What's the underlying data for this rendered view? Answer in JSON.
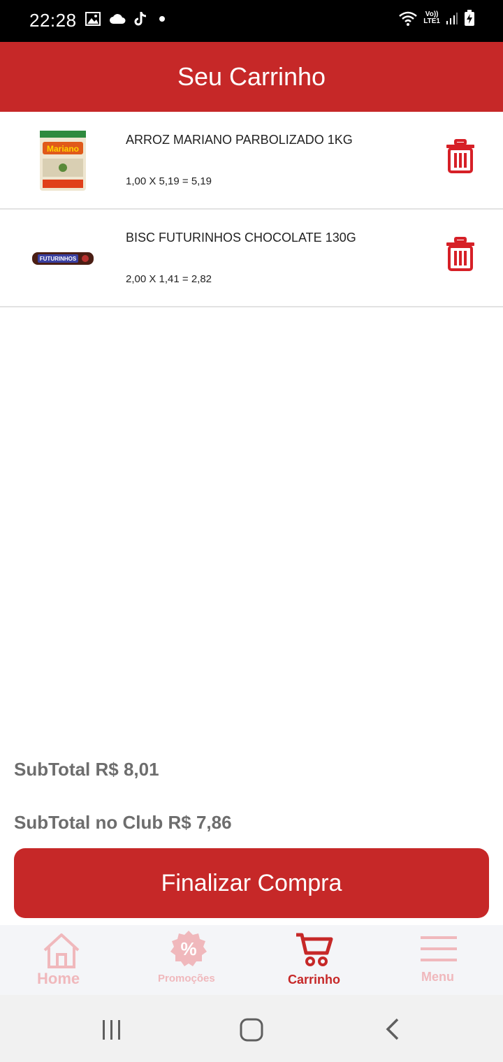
{
  "status_bar": {
    "time": "22:28",
    "left_icons": [
      "image-icon",
      "cloud-icon",
      "tiktok-icon",
      "dot-icon"
    ],
    "network_top": "Vo))",
    "network_bottom": "LTE1",
    "right_icons": [
      "wifi-icon",
      "signal-icon",
      "battery-charging-icon"
    ]
  },
  "header": {
    "title": "Seu Carrinho"
  },
  "cart": {
    "items": [
      {
        "name": "ARROZ MARIANO PARBOLIZADO 1KG",
        "calc": "1,00 X 5,19 = 5,19",
        "brand_text": "Mariano"
      },
      {
        "name": "BISC FUTURINHOS CHOCOLATE 130G",
        "calc": "2,00 X 1,41 = 2,82",
        "brand_text": "FUTURINHOS"
      }
    ]
  },
  "totals": {
    "subtotal": "SubTotal R$ 8,01",
    "subtotal_club": "SubTotal no Club R$ 7,86"
  },
  "checkout": {
    "label": "Finalizar Compra"
  },
  "bottom_nav": {
    "items": [
      {
        "label": "Home",
        "icon": "home-icon",
        "active": false
      },
      {
        "label": "Promoções",
        "icon": "percent-badge-icon",
        "active": false
      },
      {
        "label": "Carrinho",
        "icon": "cart-icon",
        "active": true
      },
      {
        "label": "Menu",
        "icon": "menu-icon",
        "active": false
      }
    ]
  },
  "colors": {
    "brand_red": "#c62828",
    "nav_inactive": "#f0b8bc",
    "subtotal_text": "#6d6d6d"
  }
}
